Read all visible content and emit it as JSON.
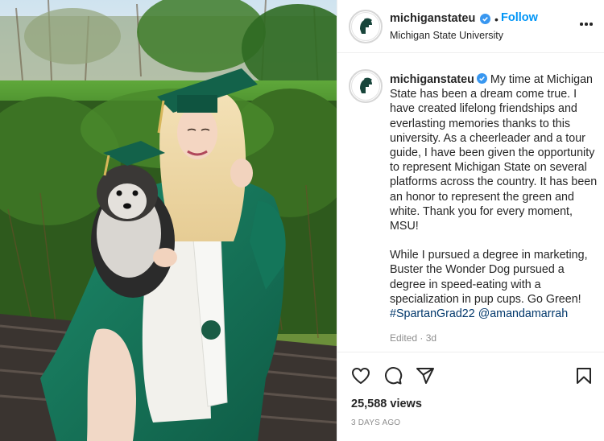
{
  "post": {
    "account": {
      "username": "michiganstateu",
      "display_name": "Michigan State University",
      "follow_label": "Follow",
      "separator": "•",
      "verified": true
    },
    "caption": {
      "username": "michiganstateu",
      "paragraph_1": "My time at Michigan State has been a dream come true. I have created lifelong friendships and everlasting memories thanks to this university. As a cheerleader and a tour guide, I have been given the opportunity to represent Michigan State on several platforms across the country. It has been an honor to represent the green and white. Thank you for every moment, MSU!",
      "paragraph_2": "While I pursued a degree in marketing, Buster the Wonder Dog pursued a degree in speed-eating with a specialization in pup cups. Go Green!",
      "hashtag": "#SpartanGrad22",
      "mention": "@amandamarrah",
      "edited": "Edited · 3d"
    },
    "stats": {
      "views": "25,588 views",
      "posted_ago": "3 DAYS AGO"
    }
  },
  "icons": {
    "verified": "verified-badge-icon",
    "more": "more-options-icon",
    "like": "heart-icon",
    "comment": "comment-bubble-icon",
    "share": "paper-plane-icon",
    "save": "bookmark-icon"
  },
  "colors": {
    "link_blue": "#0095f6",
    "tag_blue": "#00376b",
    "spartan_green": "#18453b",
    "muted_text": "#8e8e8e"
  }
}
